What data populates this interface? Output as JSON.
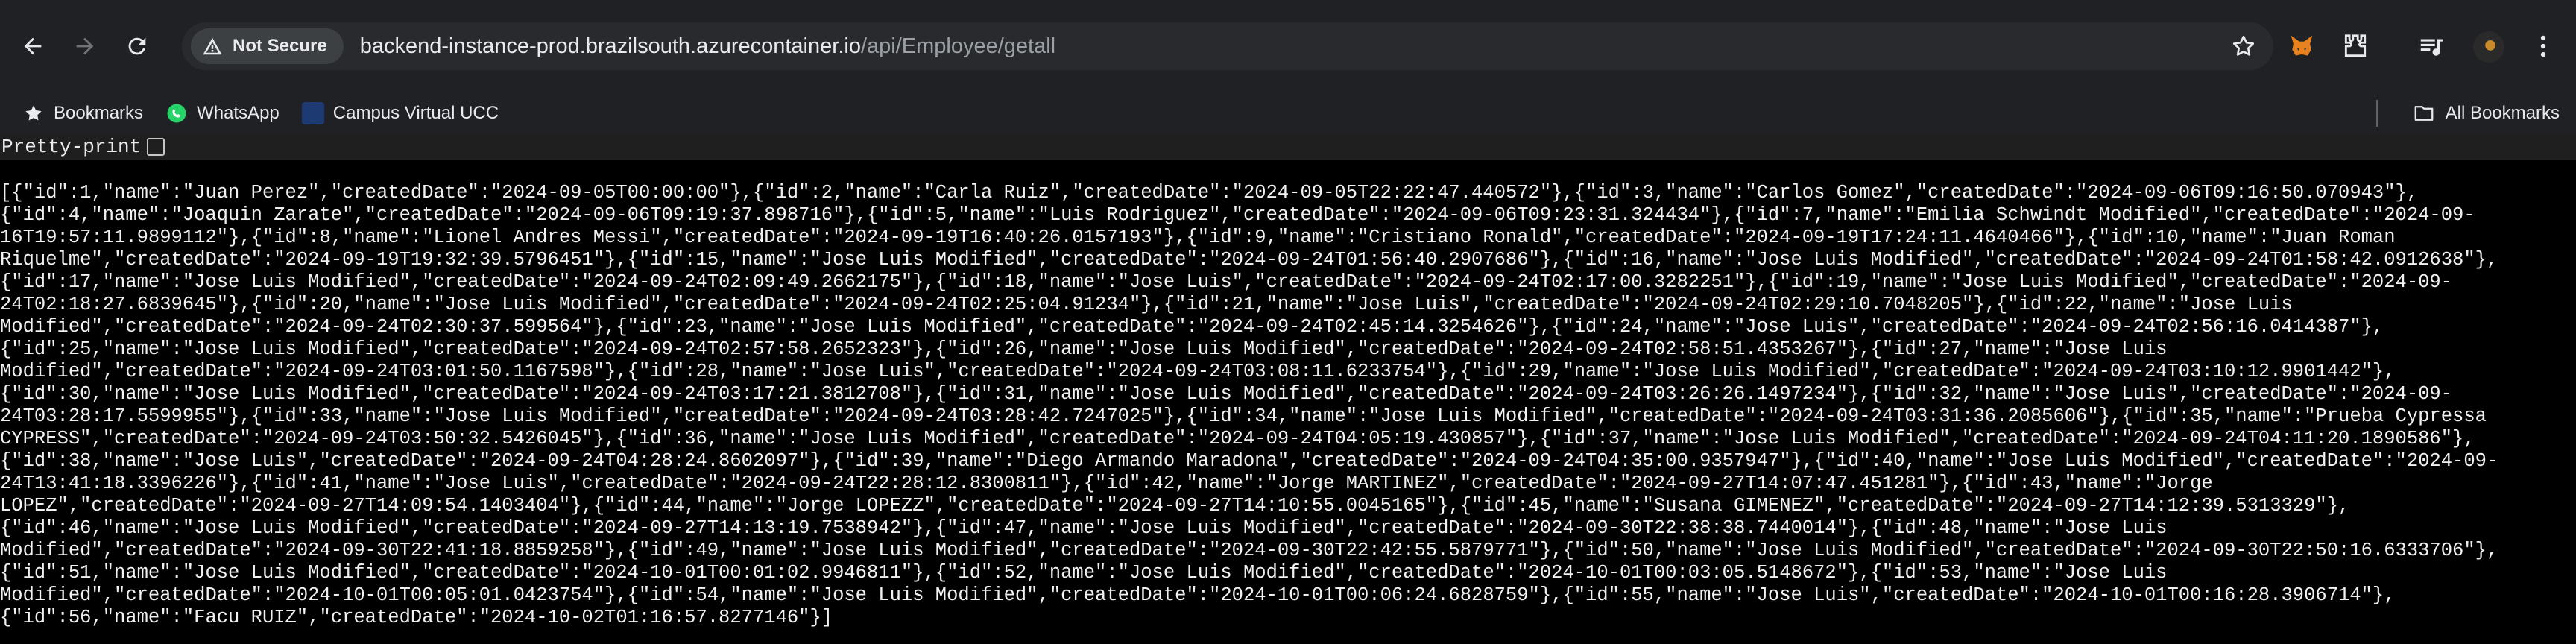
{
  "browser": {
    "security_label": "Not Secure",
    "url_host": "backend-instance-prod.brazilsouth.azurecontainer.io",
    "url_path": "/api/Employee/getall"
  },
  "bookmarks": {
    "items": [
      {
        "label": "Bookmarks",
        "icon": "star-icon"
      },
      {
        "label": "WhatsApp",
        "icon": "whatsapp-icon"
      },
      {
        "label": "Campus Virtual UCC",
        "icon": "campus-icon"
      }
    ],
    "all_label": "All Bookmarks"
  },
  "pretty_print": {
    "label": "Pretty-print",
    "checked": false
  },
  "json_lines": [
    "[{\"id\":1,\"name\":\"Juan Perez\",\"createdDate\":\"2024-09-05T00:00:00\"},{\"id\":2,\"name\":\"Carla Ruiz\",\"createdDate\":\"2024-09-05T22:22:47.440572\"},{\"id\":3,\"name\":\"Carlos Gomez\",\"createdDate\":\"2024-09-06T09:16:50.070943\"},",
    "{\"id\":4,\"name\":\"Joaquin Zarate\",\"createdDate\":\"2024-09-06T09:19:37.898716\"},{\"id\":5,\"name\":\"Luis Rodriguez\",\"createdDate\":\"2024-09-06T09:23:31.324434\"},{\"id\":7,\"name\":\"Emilia Schwindt Modified\",\"createdDate\":\"2024-09-",
    "16T19:57:11.9899112\"},{\"id\":8,\"name\":\"Lionel Andres Messi\",\"createdDate\":\"2024-09-19T16:40:26.0157193\"},{\"id\":9,\"name\":\"Cristiano Ronald\",\"createdDate\":\"2024-09-19T17:24:11.4640466\"},{\"id\":10,\"name\":\"Juan Roman",
    "Riquelme\",\"createdDate\":\"2024-09-19T19:32:39.5796451\"},{\"id\":15,\"name\":\"Jose Luis Modified\",\"createdDate\":\"2024-09-24T01:56:40.2907686\"},{\"id\":16,\"name\":\"Jose Luis Modified\",\"createdDate\":\"2024-09-24T01:58:42.0912638\"},",
    "{\"id\":17,\"name\":\"Jose Luis Modified\",\"createdDate\":\"2024-09-24T02:09:49.2662175\"},{\"id\":18,\"name\":\"Jose Luis\",\"createdDate\":\"2024-09-24T02:17:00.3282251\"},{\"id\":19,\"name\":\"Jose Luis Modified\",\"createdDate\":\"2024-09-",
    "24T02:18:27.6839645\"},{\"id\":20,\"name\":\"Jose Luis Modified\",\"createdDate\":\"2024-09-24T02:25:04.91234\"},{\"id\":21,\"name\":\"Jose Luis\",\"createdDate\":\"2024-09-24T02:29:10.7048205\"},{\"id\":22,\"name\":\"Jose Luis",
    "Modified\",\"createdDate\":\"2024-09-24T02:30:37.599564\"},{\"id\":23,\"name\":\"Jose Luis Modified\",\"createdDate\":\"2024-09-24T02:45:14.3254626\"},{\"id\":24,\"name\":\"Jose Luis\",\"createdDate\":\"2024-09-24T02:56:16.0414387\"},",
    "{\"id\":25,\"name\":\"Jose Luis Modified\",\"createdDate\":\"2024-09-24T02:57:58.2652323\"},{\"id\":26,\"name\":\"Jose Luis Modified\",\"createdDate\":\"2024-09-24T02:58:51.4353267\"},{\"id\":27,\"name\":\"Jose Luis",
    "Modified\",\"createdDate\":\"2024-09-24T03:01:50.1167598\"},{\"id\":28,\"name\":\"Jose Luis\",\"createdDate\":\"2024-09-24T03:08:11.6233754\"},{\"id\":29,\"name\":\"Jose Luis Modified\",\"createdDate\":\"2024-09-24T03:10:12.9901442\"},",
    "{\"id\":30,\"name\":\"Jose Luis Modified\",\"createdDate\":\"2024-09-24T03:17:21.3812708\"},{\"id\":31,\"name\":\"Jose Luis Modified\",\"createdDate\":\"2024-09-24T03:26:26.1497234\"},{\"id\":32,\"name\":\"Jose Luis\",\"createdDate\":\"2024-09-",
    "24T03:28:17.5599955\"},{\"id\":33,\"name\":\"Jose Luis Modified\",\"createdDate\":\"2024-09-24T03:28:42.7247025\"},{\"id\":34,\"name\":\"Jose Luis Modified\",\"createdDate\":\"2024-09-24T03:31:36.2085606\"},{\"id\":35,\"name\":\"Prueba Cypressa",
    "CYPRESS\",\"createdDate\":\"2024-09-24T03:50:32.5426045\"},{\"id\":36,\"name\":\"Jose Luis Modified\",\"createdDate\":\"2024-09-24T04:05:19.430857\"},{\"id\":37,\"name\":\"Jose Luis Modified\",\"createdDate\":\"2024-09-24T04:11:20.1890586\"},",
    "{\"id\":38,\"name\":\"Jose Luis\",\"createdDate\":\"2024-09-24T04:28:24.8602097\"},{\"id\":39,\"name\":\"Diego Armando Maradona\",\"createdDate\":\"2024-09-24T04:35:00.9357947\"},{\"id\":40,\"name\":\"Jose Luis Modified\",\"createdDate\":\"2024-09-",
    "24T13:41:18.3396226\"},{\"id\":41,\"name\":\"Jose Luis\",\"createdDate\":\"2024-09-24T22:28:12.8300811\"},{\"id\":42,\"name\":\"Jorge MARTINEZ\",\"createdDate\":\"2024-09-27T14:07:47.451281\"},{\"id\":43,\"name\":\"Jorge",
    "LOPEZ\",\"createdDate\":\"2024-09-27T14:09:54.1403404\"},{\"id\":44,\"name\":\"Jorge LOPEZZ\",\"createdDate\":\"2024-09-27T14:10:55.0045165\"},{\"id\":45,\"name\":\"Susana GIMENEZ\",\"createdDate\":\"2024-09-27T14:12:39.5313329\"},",
    "{\"id\":46,\"name\":\"Jose Luis Modified\",\"createdDate\":\"2024-09-27T14:13:19.7538942\"},{\"id\":47,\"name\":\"Jose Luis Modified\",\"createdDate\":\"2024-09-30T22:38:38.7440014\"},{\"id\":48,\"name\":\"Jose Luis",
    "Modified\",\"createdDate\":\"2024-09-30T22:41:18.8859258\"},{\"id\":49,\"name\":\"Jose Luis Modified\",\"createdDate\":\"2024-09-30T22:42:55.5879771\"},{\"id\":50,\"name\":\"Jose Luis Modified\",\"createdDate\":\"2024-09-30T22:50:16.6333706\"},",
    "{\"id\":51,\"name\":\"Jose Luis Modified\",\"createdDate\":\"2024-10-01T00:01:02.9946811\"},{\"id\":52,\"name\":\"Jose Luis Modified\",\"createdDate\":\"2024-10-01T00:03:05.5148672\"},{\"id\":53,\"name\":\"Jose Luis",
    "Modified\",\"createdDate\":\"2024-10-01T00:05:01.0423754\"},{\"id\":54,\"name\":\"Jose Luis Modified\",\"createdDate\":\"2024-10-01T00:06:24.6828759\"},{\"id\":55,\"name\":\"Jose Luis\",\"createdDate\":\"2024-10-01T00:16:28.3906714\"},",
    "{\"id\":56,\"name\":\"Facu RUIZ\",\"createdDate\":\"2024-10-02T01:16:57.8277146\"}]"
  ]
}
